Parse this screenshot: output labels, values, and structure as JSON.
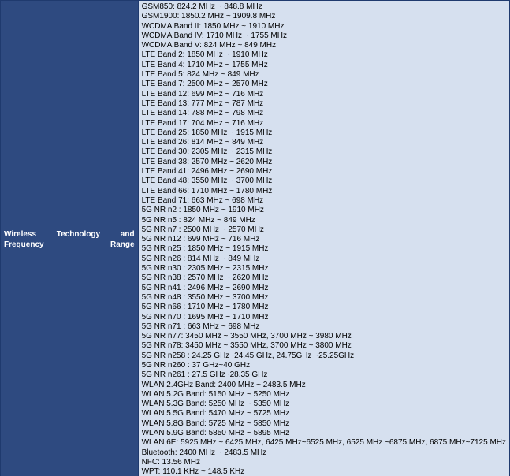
{
  "label": "Wireless Technology and Frequency Range",
  "lines": [
    "GSM850: 824.2 MHz ~ 848.8 MHz",
    "GSM1900: 1850.2 MHz ~ 1909.8 MHz",
    "WCDMA Band II: 1850 MHz ~ 1910 MHz",
    "WCDMA Band IV: 1710 MHz ~ 1755 MHz",
    "WCDMA Band V: 824 MHz ~ 849 MHz",
    "LTE Band 2: 1850 MHz ~ 1910 MHz",
    "LTE Band 4: 1710 MHz ~ 1755 MHz",
    "LTE Band 5: 824 MHz ~ 849 MHz",
    "LTE Band 7: 2500 MHz ~ 2570 MHz",
    "LTE Band 12: 699 MHz ~ 716 MHz",
    "LTE Band 13: 777 MHz ~ 787 MHz",
    "LTE Band 14: 788 MHz ~ 798 MHz",
    "LTE Band 17: 704 MHz ~ 716 MHz",
    "LTE Band 25: 1850 MHz ~ 1915 MHz",
    "LTE Band 26: 814 MHz ~ 849 MHz",
    "LTE Band 30: 2305 MHz ~ 2315 MHz",
    "LTE Band 38: 2570 MHz ~ 2620 MHz",
    "LTE Band 41: 2496 MHz ~ 2690 MHz",
    "LTE Band 48: 3550 MHz ~ 3700 MHz",
    "LTE Band 66: 1710 MHz ~ 1780 MHz",
    "LTE Band 71: 663 MHz ~ 698 MHz",
    "5G NR n2 : 1850 MHz ~ 1910 MHz",
    "5G NR n5 : 824 MHz ~ 849 MHz",
    "5G NR n7 : 2500 MHz ~ 2570 MHz",
    "5G NR n12 : 699 MHz ~ 716 MHz",
    "5G NR n25 : 1850 MHz ~ 1915 MHz",
    "5G NR n26 : 814 MHz ~ 849 MHz",
    "5G NR n30 : 2305 MHz ~ 2315 MHz",
    "5G NR n38 : 2570 MHz ~ 2620 MHz",
    "5G NR n41 : 2496 MHz ~ 2690 MHz",
    "5G NR n48 : 3550 MHz ~ 3700 MHz",
    "5G NR n66 : 1710 MHz ~ 1780 MHz",
    "5G NR n70 : 1695 MHz ~ 1710 MHz",
    "5G NR n71 : 663 MHz ~ 698 MHz",
    "5G NR n77: 3450 MHz ~ 3550 MHz, 3700 MHz ~ 3980 MHz",
    "5G NR n78: 3450 MHz ~ 3550 MHz, 3700 MHz ~ 3800 MHz",
    "5G NR n258 : 24.25 GHz~24.45 GHz, 24.75GHz ~25.25GHz",
    "5G NR n260 : 37 GHz~40 GHz",
    "5G NR n261 : 27.5 GHz~28.35 GHz",
    "WLAN 2.4GHz Band: 2400 MHz ~ 2483.5 MHz",
    "WLAN 5.2G Band: 5150 MHz ~ 5250 MHz",
    "WLAN 5.3G Band: 5250 MHz ~ 5350 MHz",
    "WLAN 5.5G Band: 5470 MHz ~ 5725 MHz",
    "WLAN 5.8G Band: 5725 MHz ~ 5850 MHz",
    "WLAN 5.9G Band: 5850 MHz ~ 5895 MHz",
    "WLAN 6E: 5925 MHz ~ 6425 MHz, 6425 MHz~6525 MHz, 6525 MHz ~6875 MHz, 6875 MHz~7125 MHz",
    "Bluetooth: 2400 MHz ~ 2483.5 MHz",
    "NFC: 13.56 MHz",
    "WPT: 110.1 KHz ~ 148.5 KHz"
  ]
}
